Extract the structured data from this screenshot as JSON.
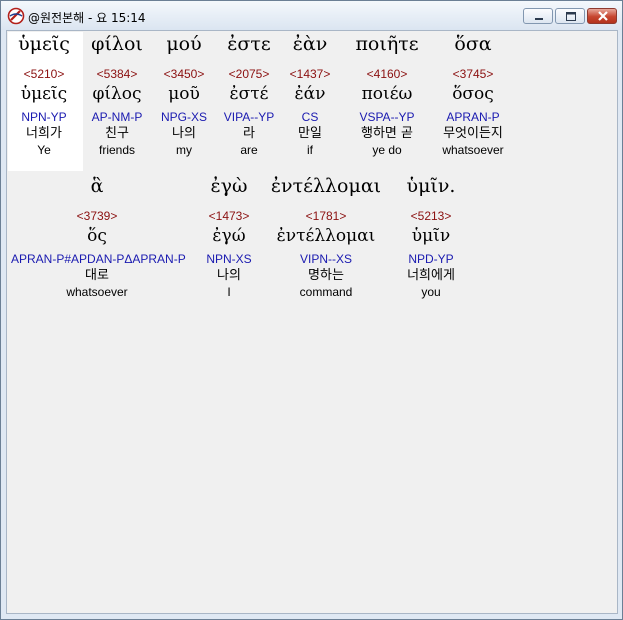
{
  "window": {
    "title": "@원전본해 - 요 15:14"
  },
  "colors": {
    "strong_number": "#8b1010",
    "morphology": "#1a1ab0",
    "highlight": "#ffffff"
  },
  "words": [
    {
      "greek": "ὑμεῖς",
      "strong": "<5210>",
      "lemma": "ὑμεῖς",
      "morph": "NPN-YP",
      "korean": "너희가",
      "english": "Ye"
    },
    {
      "greek": "φίλοι",
      "strong": "<5384>",
      "lemma": "φίλος",
      "morph": "AP-NM-P",
      "korean": "친구",
      "english": "friends"
    },
    {
      "greek": "μού",
      "strong": "<3450>",
      "lemma": "μοῦ",
      "morph": "NPG-XS",
      "korean": "나의",
      "english": "my"
    },
    {
      "greek": "ἐστε",
      "strong": "<2075>",
      "lemma": "ἐστέ",
      "morph": "VIPA--YP",
      "korean": "라",
      "english": "are"
    },
    {
      "greek": "ἐὰν",
      "strong": "<1437>",
      "lemma": "ἐάν",
      "morph": "CS",
      "korean": "만일",
      "english": "if"
    },
    {
      "greek": "ποιῆτε",
      "strong": "<4160>",
      "lemma": "ποιέω",
      "morph": "VSPA--YP",
      "korean": "행하면 곧",
      "english": "ye do"
    },
    {
      "greek": "ὅσα",
      "strong": "<3745>",
      "lemma": "ὅσος",
      "morph": "APRAN-P",
      "korean": "무엇이든지",
      "english": "whatsoever"
    },
    {
      "greek": "ἃ",
      "strong": "<3739>",
      "lemma": "ὅς",
      "morph": "APRAN-P#APDAN-PΔAPRAN-P",
      "korean": "대로",
      "english": "whatsoever"
    },
    {
      "greek": "ἐγὼ",
      "strong": "<1473>",
      "lemma": "ἐγώ",
      "morph": "NPN-XS",
      "korean": "나의",
      "english": "I"
    },
    {
      "greek": "ἐντέλλομαι",
      "strong": "<1781>",
      "lemma": "ἐντέλλομαι",
      "morph": "VIPN--XS",
      "korean": "명하는",
      "english": "command"
    },
    {
      "greek": "ὑμῖν.",
      "strong": "<5213>",
      "lemma": "ὑμῖν",
      "morph": "NPD-YP",
      "korean": "너희에게",
      "english": "you"
    }
  ]
}
